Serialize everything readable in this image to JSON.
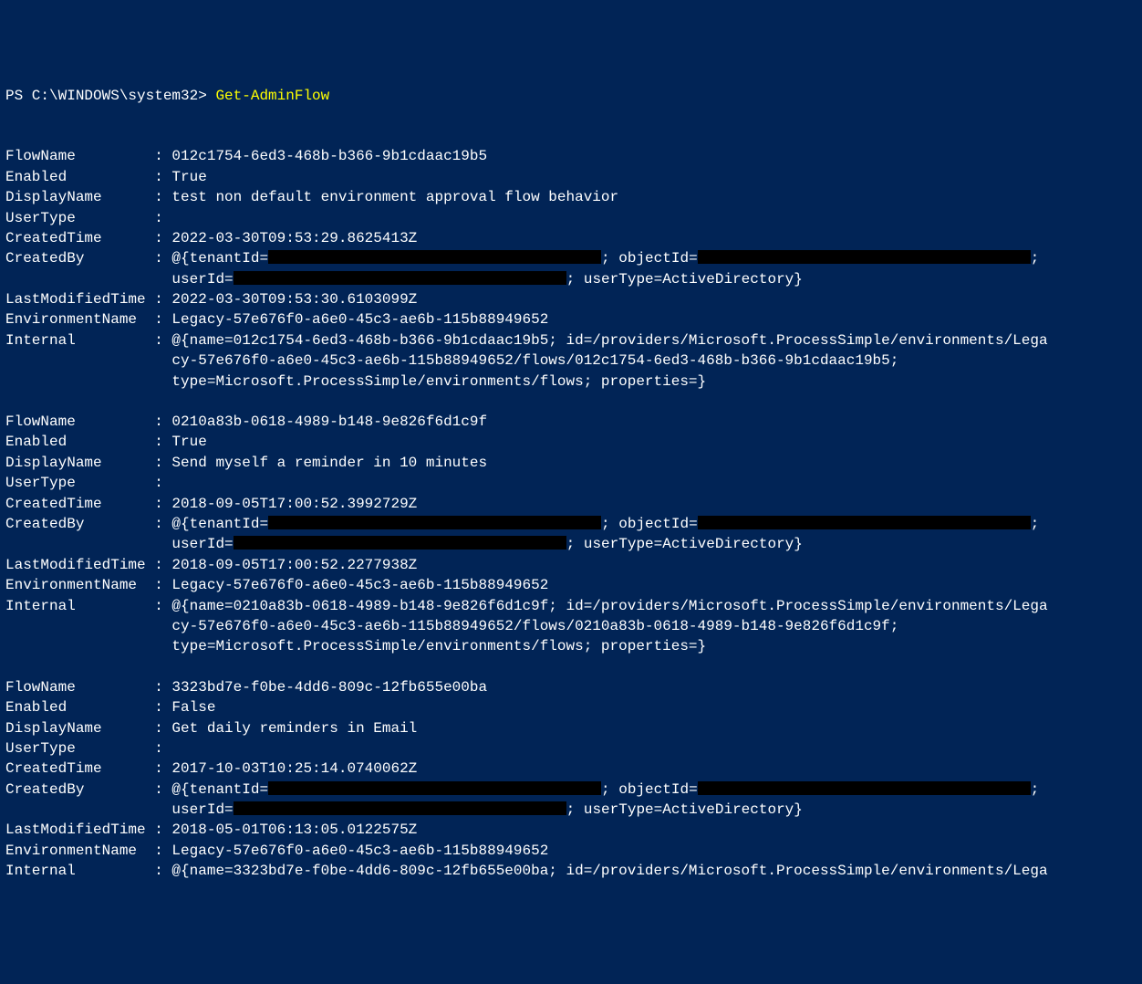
{
  "prompt": {
    "path": "PS C:\\WINDOWS\\system32> ",
    "command": "Get-AdminFlow"
  },
  "records": [
    {
      "FlowName": "012c1754-6ed3-468b-b366-9b1cdaac19b5",
      "Enabled": "True",
      "DisplayName": "test non default environment approval flow behavior",
      "UserType": "",
      "CreatedTime": "2022-03-30T09:53:29.8625413Z",
      "CreatedBy_pre": "@{tenantId=",
      "CreatedBy_mid1": "; objectId=",
      "CreatedBy_mid2": ";",
      "CreatedBy_line2_pre": "                   userId=",
      "CreatedBy_line2_post": "; userType=ActiveDirectory}",
      "LastModifiedTime": "2022-03-30T09:53:30.6103099Z",
      "EnvironmentName": "Legacy-57e676f0-a6e0-45c3-ae6b-115b88949652",
      "Internal_l1": "@{name=012c1754-6ed3-468b-b366-9b1cdaac19b5; id=/providers/Microsoft.ProcessSimple/environments/Lega",
      "Internal_l2": "                   cy-57e676f0-a6e0-45c3-ae6b-115b88949652/flows/012c1754-6ed3-468b-b366-9b1cdaac19b5;",
      "Internal_l3": "                   type=Microsoft.ProcessSimple/environments/flows; properties=}"
    },
    {
      "FlowName": "0210a83b-0618-4989-b148-9e826f6d1c9f",
      "Enabled": "True",
      "DisplayName": "Send myself a reminder in 10 minutes",
      "UserType": "",
      "CreatedTime": "2018-09-05T17:00:52.3992729Z",
      "CreatedBy_pre": "@{tenantId=",
      "CreatedBy_mid1": "; objectId=",
      "CreatedBy_mid2": ";",
      "CreatedBy_line2_pre": "                   userId=",
      "CreatedBy_line2_post": "; userType=ActiveDirectory}",
      "LastModifiedTime": "2018-09-05T17:00:52.2277938Z",
      "EnvironmentName": "Legacy-57e676f0-a6e0-45c3-ae6b-115b88949652",
      "Internal_l1": "@{name=0210a83b-0618-4989-b148-9e826f6d1c9f; id=/providers/Microsoft.ProcessSimple/environments/Lega",
      "Internal_l2": "                   cy-57e676f0-a6e0-45c3-ae6b-115b88949652/flows/0210a83b-0618-4989-b148-9e826f6d1c9f;",
      "Internal_l3": "                   type=Microsoft.ProcessSimple/environments/flows; properties=}"
    },
    {
      "FlowName": "3323bd7e-f0be-4dd6-809c-12fb655e00ba",
      "Enabled": "False",
      "DisplayName": "Get daily reminders in Email",
      "UserType": "",
      "CreatedTime": "2017-10-03T10:25:14.0740062Z",
      "CreatedBy_pre": "@{tenantId=",
      "CreatedBy_mid1": "; objectId=",
      "CreatedBy_mid2": ";",
      "CreatedBy_line2_pre": "                   userId=",
      "CreatedBy_line2_post": "; userType=ActiveDirectory}",
      "LastModifiedTime": "2018-05-01T06:13:05.0122575Z",
      "EnvironmentName": "Legacy-57e676f0-a6e0-45c3-ae6b-115b88949652",
      "Internal_l1": "@{name=3323bd7e-f0be-4dd6-809c-12fb655e00ba; id=/providers/Microsoft.ProcessSimple/environments/Lega",
      "Internal_l2": "",
      "Internal_l3": ""
    }
  ],
  "labels": {
    "FlowName": "FlowName         : ",
    "Enabled": "Enabled          : ",
    "DisplayName": "DisplayName      : ",
    "UserType": "UserType         : ",
    "CreatedTime": "CreatedTime      : ",
    "CreatedBy": "CreatedBy        : ",
    "LastModifiedTime": "LastModifiedTime : ",
    "EnvironmentName": "EnvironmentName  : ",
    "Internal": "Internal         : "
  }
}
